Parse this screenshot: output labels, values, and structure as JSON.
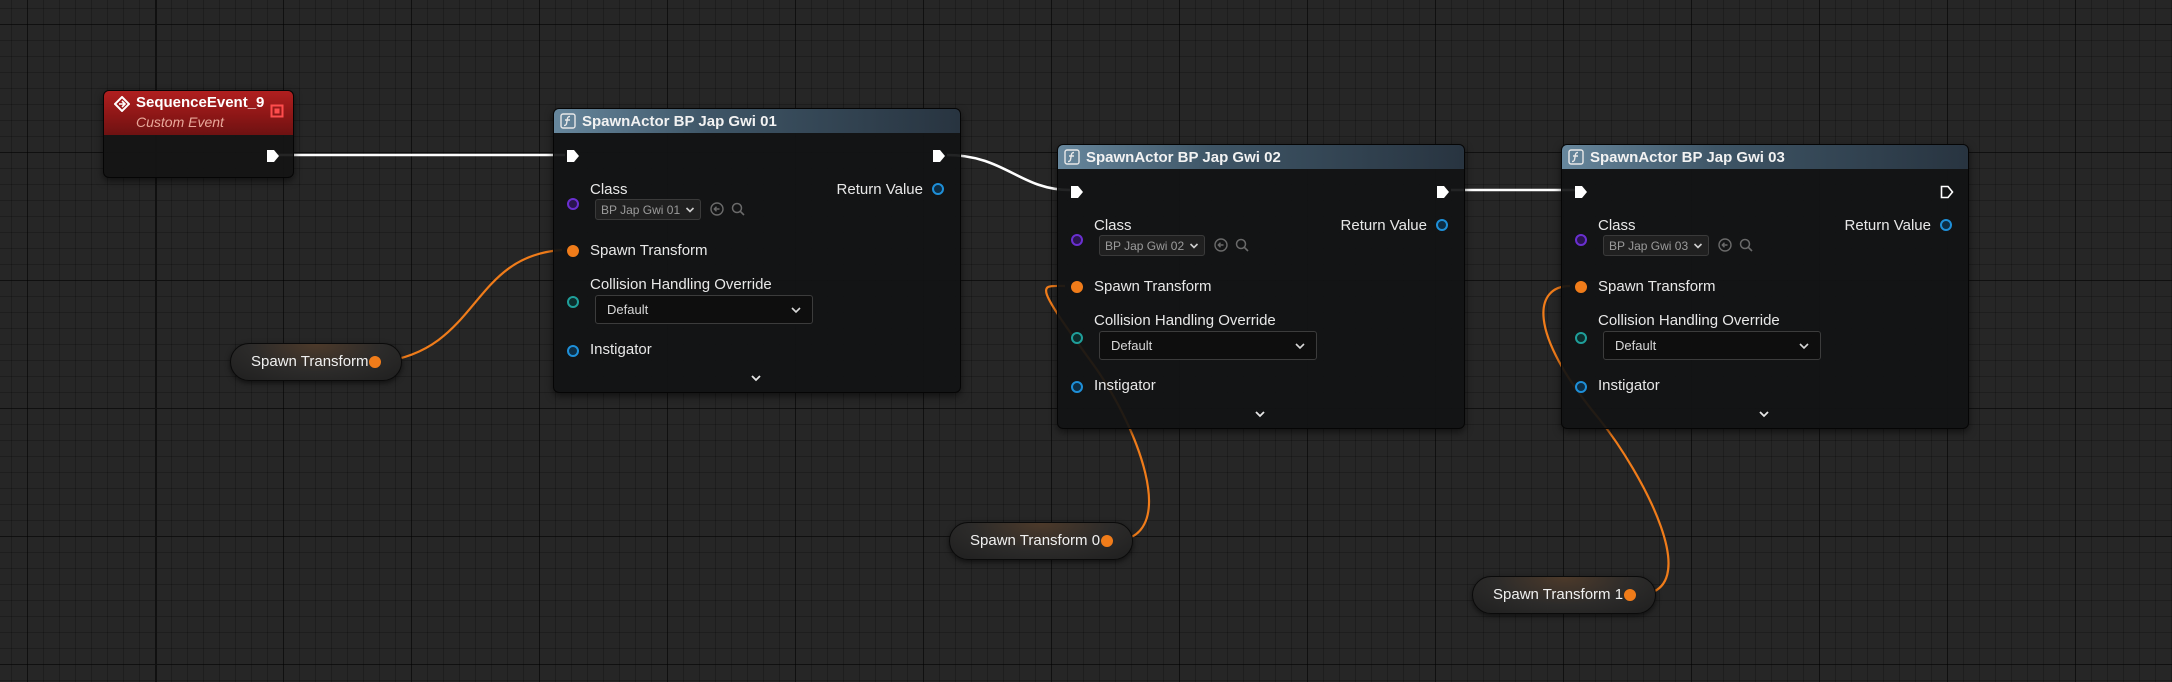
{
  "event": {
    "title": "SequenceEvent_9",
    "subtitle": "Custom Event",
    "title_color": "#ffffff",
    "subtitle_color": "#e8a89a",
    "header_color": "#9e1c1c"
  },
  "spawn_nodes": [
    {
      "title": "SpawnActor BP Jap Gwi 01",
      "class_label": "Class",
      "class_value": "BP Jap Gwi 01",
      "return_label": "Return Value",
      "spawn_transform_label": "Spawn Transform",
      "collision_label": "Collision Handling Override",
      "collision_value": "Default",
      "instigator_label": "Instigator"
    },
    {
      "title": "SpawnActor BP Jap Gwi 02",
      "class_label": "Class",
      "class_value": "BP Jap Gwi 02",
      "return_label": "Return Value",
      "spawn_transform_label": "Spawn Transform",
      "collision_label": "Collision Handling Override",
      "collision_value": "Default",
      "instigator_label": "Instigator"
    },
    {
      "title": "SpawnActor BP Jap Gwi 03",
      "class_label": "Class",
      "class_value": "BP Jap Gwi 03",
      "return_label": "Return Value",
      "spawn_transform_label": "Spawn Transform",
      "collision_label": "Collision Handling Override",
      "collision_value": "Default",
      "instigator_label": "Instigator"
    }
  ],
  "variables": [
    {
      "label": "Spawn Transform"
    },
    {
      "label": "Spawn Transform 0"
    },
    {
      "label": "Spawn Transform 1"
    }
  ],
  "colors": {
    "exec_wire": "#ffffff",
    "transform_pin": "#f07c1a",
    "class_pin": "#6a2fd0",
    "collision_pin": "#1f9f9a",
    "object_pin": "#1e8fd8",
    "header_blue": "#4e6b80"
  },
  "icons": {
    "function": "function-icon",
    "event": "event-diamond-icon",
    "delegate": "delegate-square-icon",
    "exec": "exec-arrow-icon",
    "dropdown": "chevron-down-icon",
    "browse": "arrow-left-circle-icon",
    "search": "search-icon",
    "expand": "chevron-down-icon"
  }
}
